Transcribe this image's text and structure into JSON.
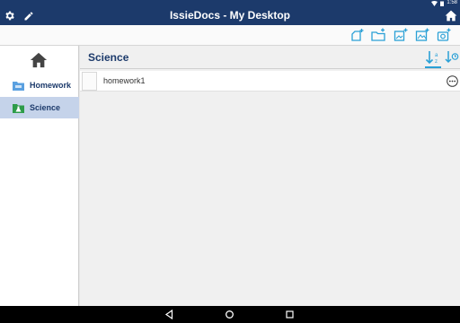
{
  "status_bar": {
    "time": "1:58"
  },
  "title_bar": {
    "title": "IssieDocs - My Desktop",
    "left_icons": [
      "gear-icon",
      "pencil-icon"
    ],
    "right_icon": "home-icon"
  },
  "toolbar": {
    "tools": [
      "new-page-icon",
      "new-folder-icon",
      "import-image-icon",
      "add-image-icon",
      "camera-icon"
    ]
  },
  "sidebar": {
    "home_icon": "home-icon",
    "items": [
      {
        "label": "Homework",
        "icon": "folder-icon",
        "color": "#5aa0e0",
        "active": false
      },
      {
        "label": "Science",
        "icon": "flask-icon",
        "color": "#2e9c4a",
        "active": true
      }
    ]
  },
  "main": {
    "title": "Science",
    "sort_icons": [
      "sort-az-icon",
      "sort-date-icon"
    ],
    "documents": [
      {
        "name": "homework1"
      }
    ]
  },
  "colors": {
    "primary": "#1c3a6b",
    "accent": "#2aa0d6",
    "active_bg": "#c5d3ea"
  }
}
